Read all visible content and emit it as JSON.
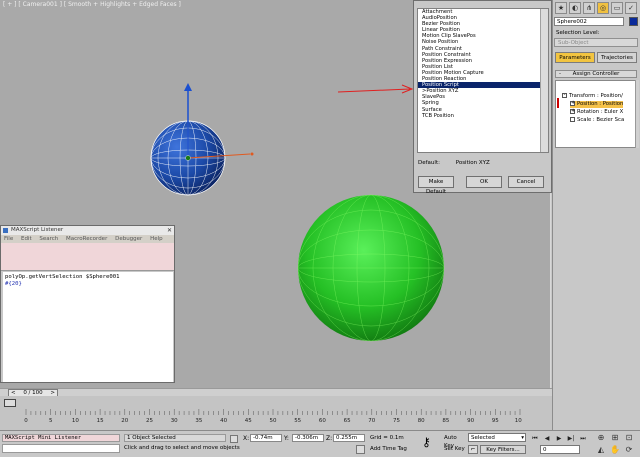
{
  "viewport": {
    "label": "[ + ] [ Camera001 ] [ Smooth + Highlights + Edged Faces ]"
  },
  "dialog": {
    "controllers": [
      "Attachment",
      "AudioPosition",
      "Bezier Position",
      "Linear Position",
      "Motion Clip SlavePos",
      "Noise Position",
      "Path Constraint",
      "Position Constraint",
      "Position Expression",
      "Position List",
      "Position Motion Capture",
      "Position Reaction",
      "Position Script",
      ">Position XYZ",
      "SlavePos",
      "Spring",
      "Surface",
      "TCB Position"
    ],
    "selected_index": 12,
    "default_label": "Default:",
    "default_value": "Position XYZ",
    "make_default_label": "Make Default",
    "ok_label": "OK",
    "cancel_label": "Cancel"
  },
  "command_panel": {
    "object_name": "Sphere002",
    "object_color": "#0a2a9a",
    "selection_level_label": "Selection Level:",
    "selection_level_value": "Sub-Object",
    "tab_parameters": "Parameters",
    "tab_trajectories": "Trajectories",
    "assign_controller_header": "Assign Controller",
    "tree": [
      "Transform : Position/",
      "Position : Position",
      "Rotation : Euler X",
      "Scale : Bezier Sca"
    ],
    "selected_tree_index": 1
  },
  "listener": {
    "title": "MAXScript Listener",
    "menu": [
      "File",
      "Edit",
      "Search",
      "MacroRecorder",
      "Debugger",
      "Help"
    ],
    "command": "polyOp.getVertSelection $Sphere001",
    "result": "#{20}"
  },
  "time_slider": {
    "frame_label": "0 / 100",
    "ticks": [
      "0",
      "5",
      "10",
      "15",
      "20",
      "25",
      "30",
      "35",
      "40",
      "45",
      "50",
      "55",
      "60",
      "65",
      "70",
      "75",
      "80",
      "85",
      "90",
      "95",
      "100"
    ]
  },
  "status": {
    "mini_listener": "MAXScript Mini Listener",
    "selection": "1 Object Selected",
    "prompt": "Click and drag to select and move objects",
    "x_label": "X:",
    "x_value": "-0.74m",
    "y_label": "Y:",
    "y_value": "-0.306m",
    "z_label": "Z:",
    "z_value": "0.255m",
    "grid": "Grid = 0.1m",
    "add_time_tag": "Add Time Tag",
    "auto_key": "Auto Key",
    "auto_key_mode": "Selected",
    "set_key": "Set Key",
    "key_filters": "Key Filters...",
    "frame_value": "0"
  }
}
